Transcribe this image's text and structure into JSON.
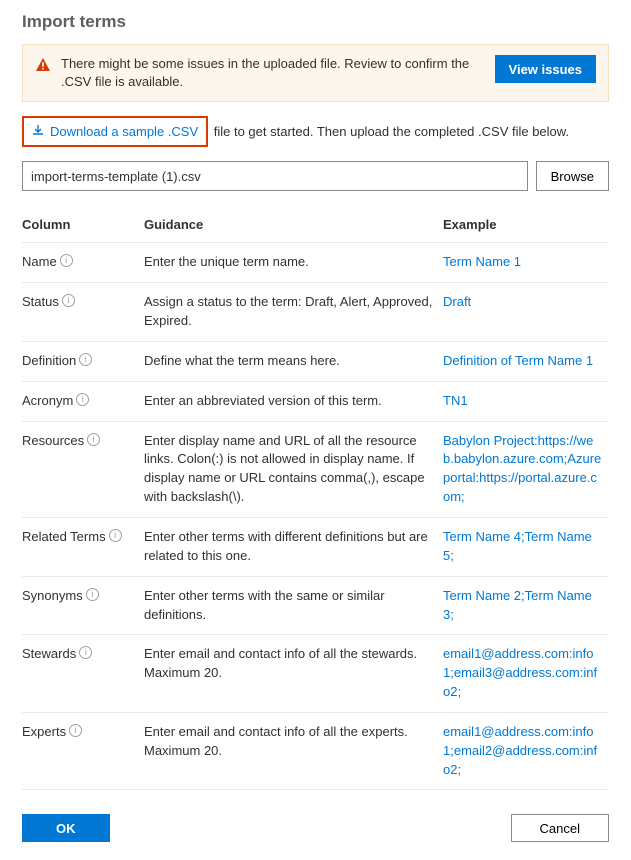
{
  "title": "Import terms",
  "alert": {
    "text": "There might be some issues in the uploaded file. Review to confirm the .CSV file is available.",
    "button": "View issues"
  },
  "download": {
    "link": "Download a sample .CSV",
    "suffix": " file to get started. Then upload the completed .CSV file below."
  },
  "file": {
    "value": "import-terms-template (1).csv",
    "browse": "Browse"
  },
  "table": {
    "headers": {
      "column": "Column",
      "guidance": "Guidance",
      "example": "Example"
    },
    "rows": [
      {
        "column": "Name",
        "guidance": "Enter the unique term name.",
        "example": "Term Name 1"
      },
      {
        "column": "Status",
        "guidance": "Assign a status to the term: Draft, Alert, Approved, Expired.",
        "example": "Draft"
      },
      {
        "column": "Definition",
        "guidance": "Define what the term means here.",
        "example": "Definition of Term Name 1"
      },
      {
        "column": "Acronym",
        "guidance": "Enter an abbreviated version of this term.",
        "example": "TN1"
      },
      {
        "column": "Resources",
        "guidance": "Enter display name and URL of all the resource links. Colon(:) is not allowed in display name. If display name or URL contains comma(,), escape with backslash(\\).",
        "example": "Babylon Project:https://web.babylon.azure.com;Azure portal:https://portal.azure.com;"
      },
      {
        "column": "Related Terms",
        "guidance": "Enter other terms with different definitions but are related to this one.",
        "example": "Term Name 4;Term Name 5;"
      },
      {
        "column": "Synonyms",
        "guidance": "Enter other terms with the same or similar definitions.",
        "example": "Term Name 2;Term Name 3;"
      },
      {
        "column": "Stewards",
        "guidance": "Enter email and contact info of all the stewards. Maximum 20.",
        "example": "email1@address.com:info1;email3@address.com:info2;"
      },
      {
        "column": "Experts",
        "guidance": "Enter email and contact info of all the experts. Maximum 20.",
        "example": "email1@address.com:info1;email2@address.com:info2;"
      }
    ]
  },
  "footer": {
    "ok": "OK",
    "cancel": "Cancel"
  }
}
